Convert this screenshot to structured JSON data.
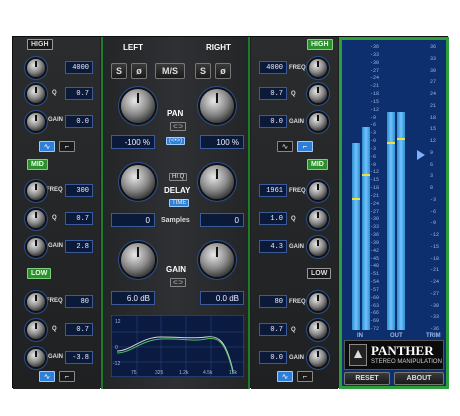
{
  "low_eq": {
    "high_band": {
      "label": "HIGH",
      "freq": "4000",
      "q": "0.7",
      "gain": "0.0"
    },
    "mid_band": {
      "label": "MID",
      "freq": "300",
      "q": "0.7",
      "gain": "2.8"
    },
    "low_band": {
      "label": "LOW",
      "freq": "80",
      "q": "0.7",
      "gain": "-3.8"
    },
    "labels": {
      "freq": "FREQ",
      "q": "Q",
      "gain": "GAIN"
    }
  },
  "right_eq": {
    "high_band": {
      "label": "HIGH",
      "freq": "4000",
      "q": "0.7",
      "gain": "0.0"
    },
    "mid_band": {
      "label": "MID",
      "freq": "1961",
      "q": "1.0",
      "gain": "4.3"
    },
    "low_band": {
      "label": "LOW",
      "freq": "80",
      "q": "0.7",
      "gain": "0.0"
    }
  },
  "center": {
    "left_label": "LEFT",
    "right_label": "RIGHT",
    "buttons": {
      "s": "S",
      "phase": "ø",
      "ms": "M/S"
    },
    "pan_label": "PAN",
    "pan_left": "-100 %",
    "pan_right": "100 %",
    "hiq_label": "HI Q",
    "delay_label": "DELAY",
    "time_label": "TIME",
    "delay_left": "0",
    "delay_right": "0",
    "samples_label": "Samples",
    "gain_label": "GAIN",
    "gain_left": "6.0 dB",
    "gain_right": "0.0 dB",
    "graph_y_ticks": [
      "12",
      "0",
      "-12"
    ],
    "graph_x_ticks": [
      "75",
      "325",
      "1.2k",
      "4.5k",
      "15k"
    ]
  },
  "meter": {
    "scale_left": [
      "-36",
      "-33",
      "-30",
      "-27",
      "-24",
      "-21",
      "-18",
      "-15",
      "-12",
      "-9",
      "-6",
      "-3",
      "-0",
      "-3",
      "-6",
      "-9",
      "-12",
      "-15",
      "-18",
      "-21",
      "-24",
      "-27",
      "-30",
      "-33",
      "-36",
      "-39",
      "-42",
      "-45",
      "-48",
      "-51",
      "-54",
      "-57",
      "-60",
      "-63",
      "-66",
      "-69",
      "-72"
    ],
    "scale_right": [
      "36",
      "33",
      "30",
      "27",
      "24",
      "21",
      "18",
      "15",
      "12",
      "9",
      "6",
      "3",
      "0",
      "-3",
      "-6",
      "-9",
      "-12",
      "-15",
      "-18",
      "-21",
      "-24",
      "-27",
      "-30",
      "-33",
      "-36"
    ],
    "in_label": "IN",
    "out_label": "OUT",
    "trim_label": "TRIM",
    "in_levels": [
      0.72,
      0.78
    ],
    "out_levels": [
      0.84,
      0.84
    ],
    "brand": "PANTHER",
    "subtitle": "STEREO MANIPULATION",
    "reset_label": "RESET",
    "about_label": "ABOUT"
  },
  "colors": {
    "accent_green": "#2e9e3a",
    "accent_blue": "#2f7fd8",
    "meter_bg": "#0e2f6e"
  }
}
